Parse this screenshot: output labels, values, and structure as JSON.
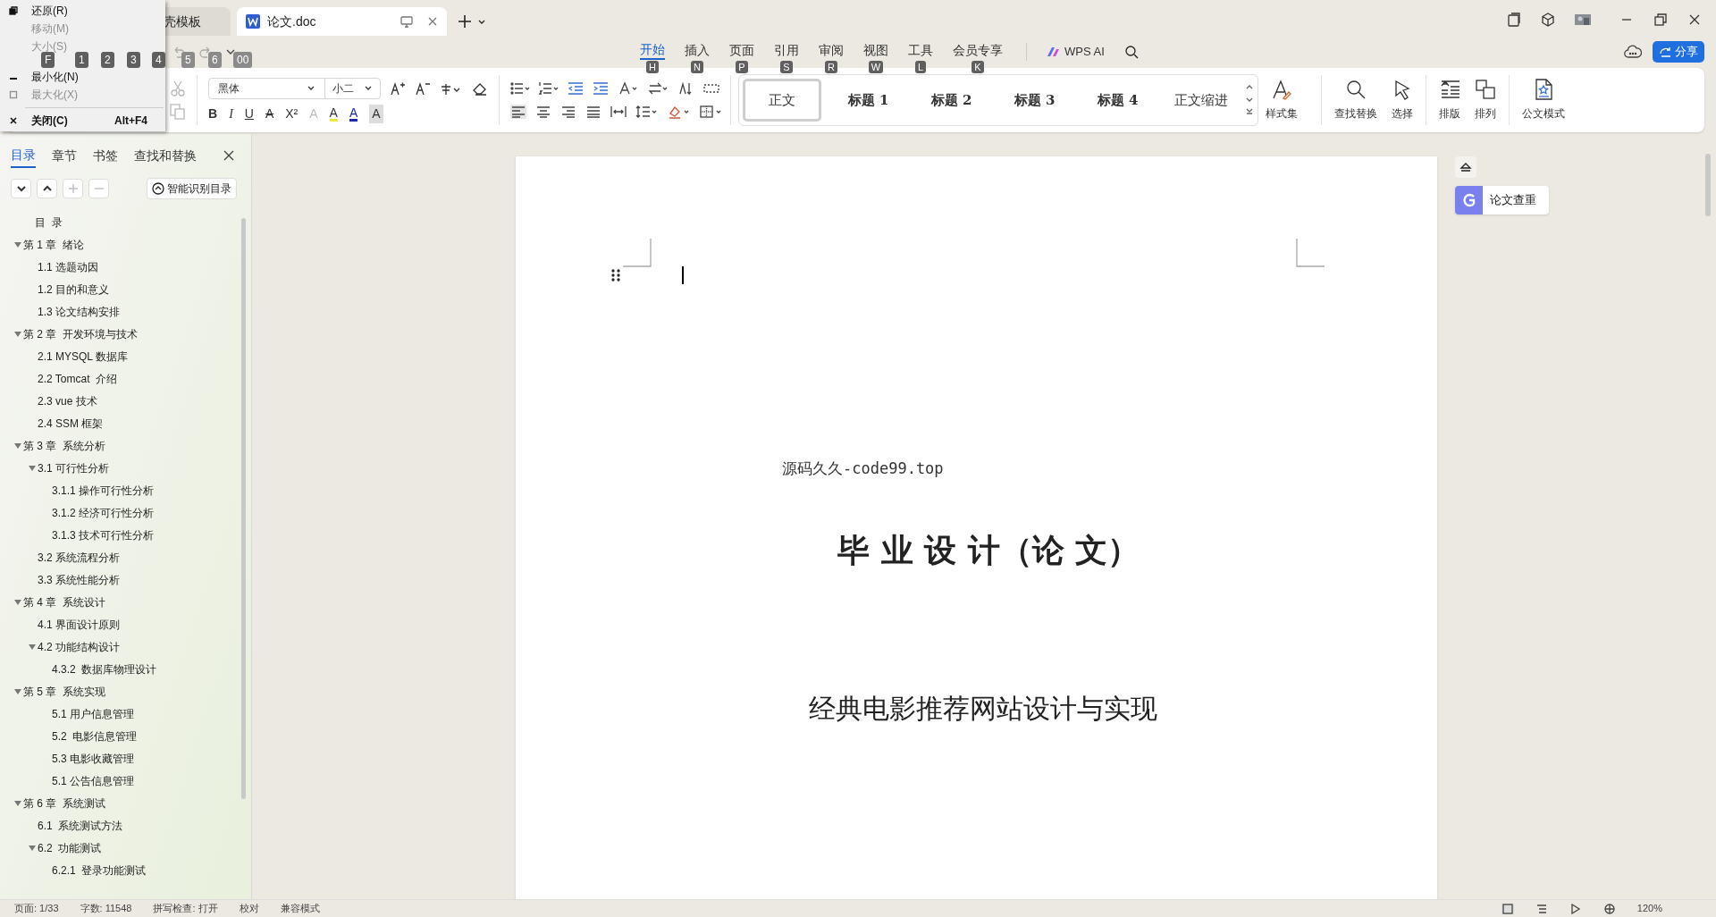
{
  "window": {
    "document_tabs": [
      {
        "label": "壳模板",
        "selected": false
      },
      {
        "label": "论文.doc",
        "selected": true
      }
    ]
  },
  "system_menu": {
    "items": [
      {
        "kind": "restore",
        "label": "还原(R)",
        "disabled": false
      },
      {
        "kind": "move",
        "label": "移动(M)",
        "disabled": true
      },
      {
        "kind": "size",
        "label": "大小(S)",
        "disabled": true
      },
      {
        "kind": "minimize",
        "label": "最小化(N)",
        "disabled": false
      },
      {
        "kind": "maximize",
        "label": "最大化(X)",
        "disabled": true
      },
      {
        "kind": "close",
        "label": "关闭(C)",
        "disabled": false,
        "shortcut": "Alt+F4"
      }
    ]
  },
  "quick_access_key_tips": [
    "F",
    "1",
    "2",
    "3",
    "4",
    "5",
    "6",
    "00"
  ],
  "ribbon_tabs": [
    {
      "label": "开始",
      "key_tip": "H",
      "selected": true
    },
    {
      "label": "插入",
      "key_tip": "N",
      "selected": false
    },
    {
      "label": "页面",
      "key_tip": "P",
      "selected": false
    },
    {
      "label": "引用",
      "key_tip": "S",
      "selected": false
    },
    {
      "label": "审阅",
      "key_tip": "R",
      "selected": false
    },
    {
      "label": "视图",
      "key_tip": "W",
      "selected": false
    },
    {
      "label": "工具",
      "key_tip": "L",
      "selected": false
    },
    {
      "label": "会员专享",
      "key_tip": "K",
      "selected": false
    }
  ],
  "wps_ai": "WPS AI",
  "share_button": "分享",
  "ribbon": {
    "font": "黑体",
    "font_size": "小二",
    "format_glyphs": [
      "B",
      "I",
      "U",
      "A",
      "X²",
      "A",
      "A",
      "A",
      "A"
    ],
    "styles": [
      {
        "label": "正文",
        "selected": true
      },
      {
        "label": "标题 1",
        "selected": false
      },
      {
        "label": "标题 2",
        "selected": false
      },
      {
        "label": "标题 3",
        "selected": false
      },
      {
        "label": "标题 4",
        "selected": false
      },
      {
        "label": "正文缩进",
        "selected": false
      }
    ],
    "large_buttons": [
      {
        "kind": "styles",
        "label": "样式集"
      },
      {
        "kind": "find",
        "label": "查找替换"
      },
      {
        "kind": "select",
        "label": "选择"
      },
      {
        "kind": "layout",
        "label": "排版"
      },
      {
        "kind": "arrange",
        "label": "排列"
      },
      {
        "kind": "official",
        "label": "公文模式"
      }
    ]
  },
  "nav_panel": {
    "tabs": [
      {
        "label": "目录",
        "selected": true
      },
      {
        "label": "章节",
        "selected": false
      },
      {
        "label": "书签",
        "selected": false
      },
      {
        "label": "查找和替换",
        "selected": false
      }
    ],
    "smart_button": "智能识别目录",
    "outline": [
      {
        "label": "目  录"
      },
      {
        "label": "第 1 章  绪论",
        "expanded": true,
        "children": [
          {
            "label": "1.1 选题动因"
          },
          {
            "label": "1.2 目的和意义"
          },
          {
            "label": "1.3 论文结构安排"
          }
        ]
      },
      {
        "label": "第 2 章  开发环境与技术",
        "expanded": true,
        "children": [
          {
            "label": "2.1 MYSQL 数据库"
          },
          {
            "label": "2.2 Tomcat  介绍"
          },
          {
            "label": "2.3 vue 技术"
          },
          {
            "label": "2.4 SSM 框架"
          }
        ]
      },
      {
        "label": "第 3 章  系统分析",
        "expanded": true,
        "children": [
          {
            "label": "3.1 可行性分析",
            "expanded": true,
            "children": [
              {
                "label": "3.1.1 操作可行性分析"
              },
              {
                "label": "3.1.2 经济可行性分析"
              },
              {
                "label": "3.1.3 技术可行性分析"
              }
            ]
          },
          {
            "label": "3.2 系统流程分析"
          },
          {
            "label": "3.3 系统性能分析"
          }
        ]
      },
      {
        "label": "第 4 章  系统设计",
        "expanded": true,
        "children": [
          {
            "label": "4.1 界面设计原则"
          },
          {
            "label": "4.2 功能结构设计",
            "expanded": true,
            "children": [
              {
                "label": "4.3.2  数据库物理设计"
              }
            ]
          }
        ]
      },
      {
        "label": "第 5 章  系统实现",
        "expanded": true,
        "children": [
          {
            "label": "5.1 用户信息管理",
            "deep": true
          },
          {
            "label": "5.2  电影信息管理",
            "deep": true
          },
          {
            "label": "5.3 电影收藏管理",
            "deep": true
          },
          {
            "label": "5.1 公告信息管理",
            "deep": true
          }
        ]
      },
      {
        "label": "第 6 章  系统测试",
        "expanded": true,
        "children": [
          {
            "label": "6.1  系统测试方法"
          },
          {
            "label": "6.2  功能测试",
            "expanded": true,
            "children": [
              {
                "label": "6.2.1  登录功能测试"
              }
            ]
          }
        ]
      }
    ]
  },
  "document": {
    "source_line": "源码久久-code99.top",
    "title": "毕 业 设 计（论 文）",
    "subtitle": "经典电影推荐网站设计与实现"
  },
  "side_tools": {
    "check_button": "论文查重"
  },
  "status_bar": {
    "items": [
      "页面: 1/33",
      "字数: 11548",
      "拼写检查: 打开",
      "校对",
      "兼容模式"
    ],
    "zoom": "120%"
  }
}
